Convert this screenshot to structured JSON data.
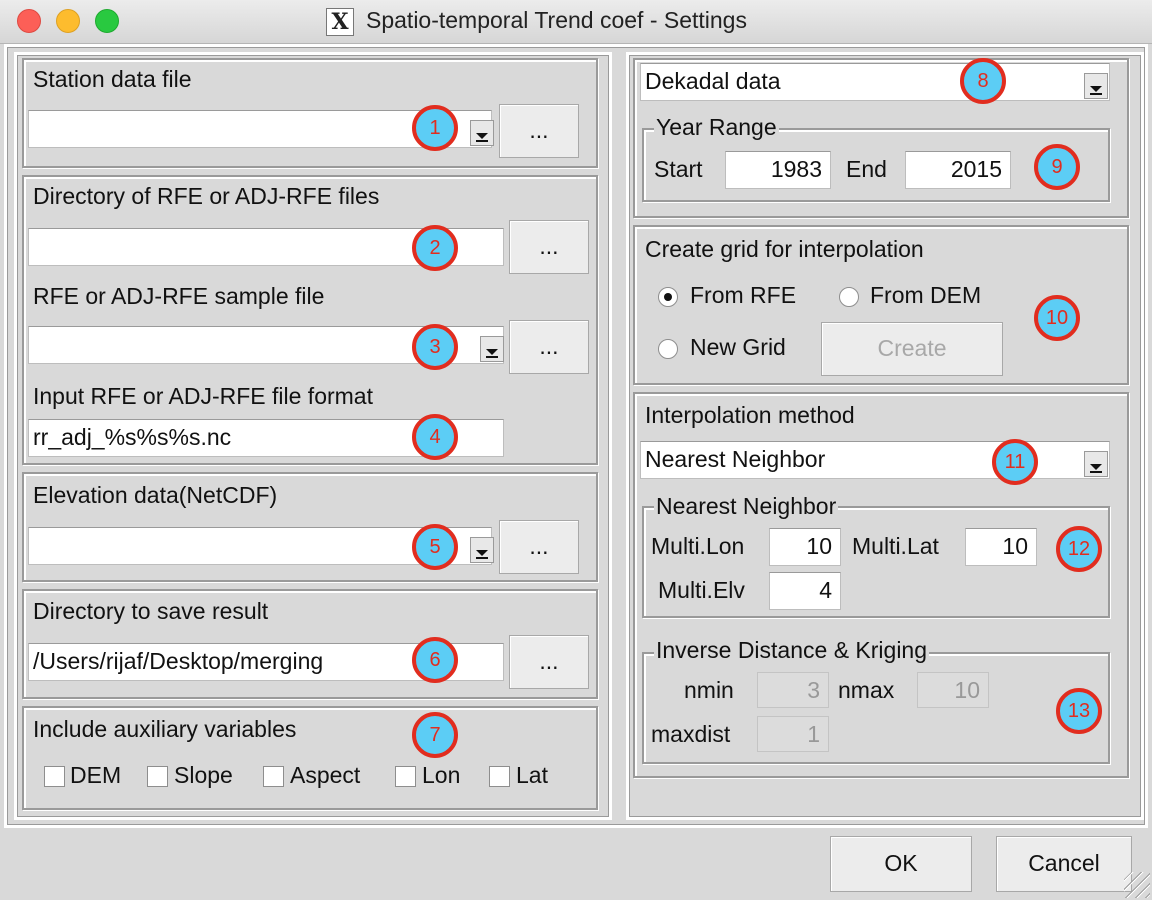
{
  "window": {
    "title": "Spatio-temporal Trend coef - Settings",
    "x_icon": "X"
  },
  "left": {
    "station": {
      "label": "Station data file",
      "value": "",
      "browse": "...",
      "badge": "1"
    },
    "rfe_dir": {
      "label": "Directory of RFE or ADJ-RFE files",
      "value": "",
      "browse": "...",
      "badge": "2"
    },
    "rfe_sample": {
      "label": "RFE or ADJ-RFE sample file",
      "value": "",
      "browse": "...",
      "badge": "3"
    },
    "rfe_format": {
      "label": "Input RFE or ADJ-RFE file format",
      "value": "rr_adj_%s%s%s.nc",
      "badge": "4"
    },
    "elevation": {
      "label": "Elevation data(NetCDF)",
      "value": "",
      "browse": "...",
      "badge": "5"
    },
    "save_dir": {
      "label": "Directory to save result",
      "value": "/Users/rijaf/Desktop/merging",
      "browse": "...",
      "badge": "6"
    },
    "aux": {
      "label": "Include auxiliary variables",
      "badge": "7",
      "options": [
        "DEM",
        "Slope",
        "Aspect",
        "Lon",
        "Lat"
      ]
    }
  },
  "right": {
    "timestep": {
      "value": "Dekadal data",
      "badge": "8"
    },
    "year_range": {
      "legend": "Year Range",
      "start_label": "Start",
      "start": "1983",
      "end_label": "End",
      "end": "2015",
      "badge": "9"
    },
    "grid": {
      "label": "Create grid for interpolation",
      "from_rfe": "From RFE",
      "from_dem": "From DEM",
      "new_grid": "New Grid",
      "create": "Create",
      "badge": "10"
    },
    "interp": {
      "label": "Interpolation method",
      "value": "Nearest Neighbor",
      "badge": "11"
    },
    "nn": {
      "legend": "Nearest Neighbor",
      "multi_lon_label": "Multi.Lon",
      "multi_lon": "10",
      "multi_lat_label": "Multi.Lat",
      "multi_lat": "10",
      "multi_elv_label": "Multi.Elv",
      "multi_elv": "4",
      "badge": "12"
    },
    "idw": {
      "legend": "Inverse Distance & Kriging",
      "nmin_label": "nmin",
      "nmin": "3",
      "nmax_label": "nmax",
      "nmax": "10",
      "maxdist_label": "maxdist",
      "maxdist": "1",
      "badge": "13"
    }
  },
  "footer": {
    "ok": "OK",
    "cancel": "Cancel"
  }
}
